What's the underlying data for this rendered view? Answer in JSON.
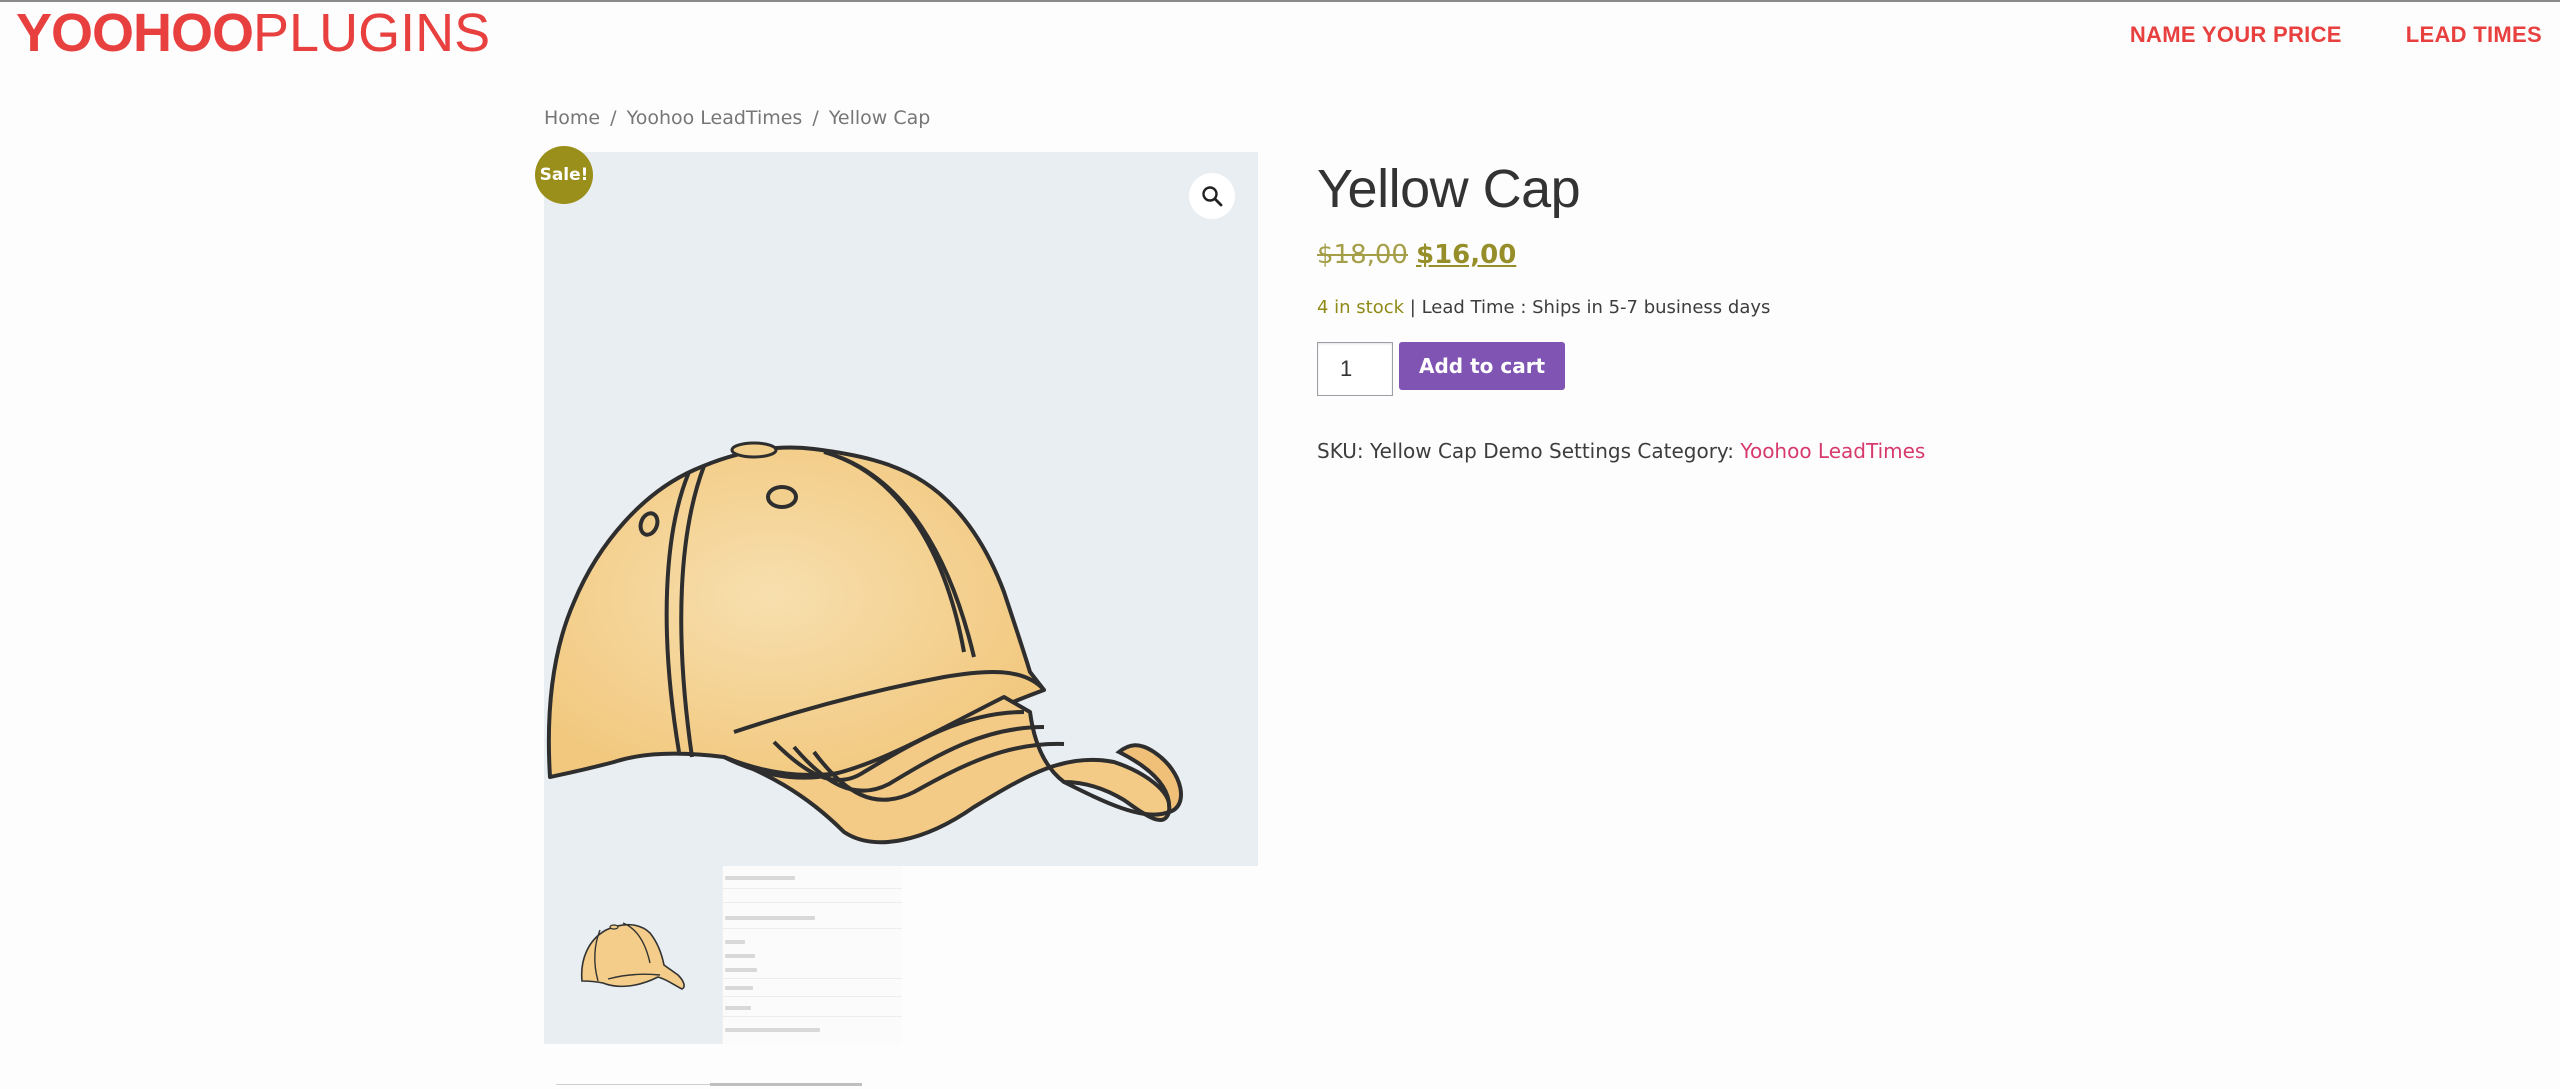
{
  "header": {
    "logo_bold": "YOOHOO",
    "logo_light": "PLUGINS",
    "nav": [
      {
        "label": "NAME YOUR PRICE"
      },
      {
        "label": "LEAD TIMES"
      }
    ]
  },
  "breadcrumb": {
    "items": [
      "Home",
      "Yoohoo LeadTimes",
      "Yellow Cap"
    ],
    "separator": "/"
  },
  "gallery": {
    "sale_badge": "Sale!",
    "zoom_icon": "magnifier-icon",
    "main_image": "yellow-cap-illustration",
    "thumbnails": [
      "yellow-cap-thumbnail",
      "settings-screenshot-thumbnail"
    ]
  },
  "product": {
    "title": "Yellow Cap",
    "regular_price": "$18,00",
    "sale_price": "$16,00",
    "stock_text": "4 in stock",
    "lead_time_text": " | Lead Time : Ships in 5-7 business days",
    "quantity": "1",
    "add_to_cart_label": "Add to cart",
    "meta": {
      "sku_label": "SKU:",
      "sku_value": "Yellow Cap Demo Settings",
      "category_label": "Category:",
      "category_value": "Yoohoo LeadTimes"
    }
  },
  "colors": {
    "brand_red": "#e8403f",
    "sale_olive": "#9a8f1a",
    "button_purple": "#7f54b3",
    "category_link": "#d63a6c",
    "image_bg": "#e9eef2"
  }
}
